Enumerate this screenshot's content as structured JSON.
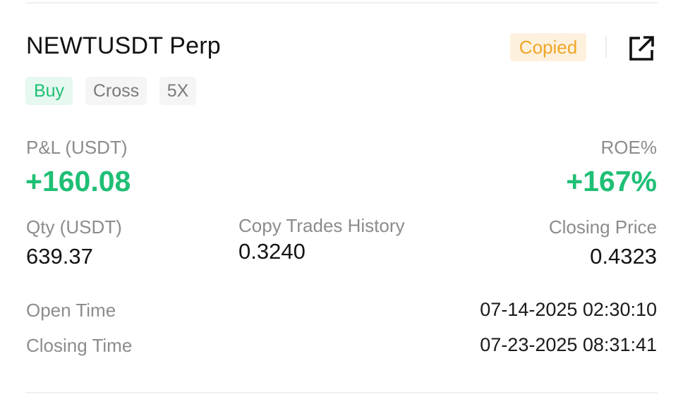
{
  "header": {
    "symbol": "NEWTUSDT Perp",
    "copied_badge": "Copied",
    "share_icon": "share-external-icon"
  },
  "tags": {
    "side": "Buy",
    "margin_mode": "Cross",
    "leverage": "5X"
  },
  "pnl": {
    "label": "P&L (USDT)",
    "value": "+160.08"
  },
  "roe": {
    "label": "ROE%",
    "value": "+167%"
  },
  "qty": {
    "label": "Qty (USDT)",
    "value": "639.37"
  },
  "copy_trades": {
    "label": "Copy Trades History",
    "value": "0.3240"
  },
  "closing_price": {
    "label": "Closing Price",
    "value": "0.4323"
  },
  "open_time": {
    "label": "Open Time",
    "value": "07-14-2025 02:30:10"
  },
  "closing_time": {
    "label": "Closing Time",
    "value": "07-23-2025 08:31:41"
  },
  "colors": {
    "profit_green": "#1fbf75",
    "copied_orange": "#f0a626",
    "copied_bg": "#fdf1de",
    "buy_bg": "#e6f8ef",
    "tag_bg": "#f5f5f5"
  }
}
